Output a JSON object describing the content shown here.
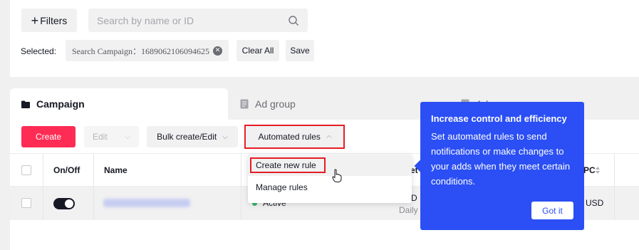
{
  "filters": {
    "button_label": "Filters"
  },
  "search": {
    "placeholder": "Search by name or ID"
  },
  "selected": {
    "label": "Selected:",
    "chip_text": "Search Campaign：1689062106094625",
    "clear_all_label": "Clear All",
    "save_label": "Save"
  },
  "tabs": [
    {
      "label": "Campaign",
      "active": true
    },
    {
      "label": "Ad group",
      "active": false
    },
    {
      "label": "Ad",
      "active": false
    }
  ],
  "toolbar": {
    "create_label": "Create",
    "edit_label": "Edit",
    "bulk_label": "Bulk create/Edit",
    "automated_label": "Automated rules"
  },
  "table": {
    "headers": {
      "on_off": "On/Off",
      "name": "Name",
      "budget": "et",
      "cpc": "PC"
    },
    "row": {
      "toggle_on": true,
      "status": "Active",
      "budget_value": "D",
      "budget_sub": "Daily",
      "cpc_value": "USD"
    }
  },
  "dropdown": {
    "items": [
      "Create new rule",
      "Manage rules"
    ]
  },
  "tooltip": {
    "title": "Increase control and efficiency",
    "body": "Set automated rules to send notifications or make changes to your adds when they meet certain conditions.",
    "button_label": "Got it"
  },
  "colors": {
    "accent_red": "#fe2c55",
    "tooltip_blue": "#2b4ff4",
    "highlight_red": "#e51c23",
    "status_green": "#3ab56b"
  }
}
